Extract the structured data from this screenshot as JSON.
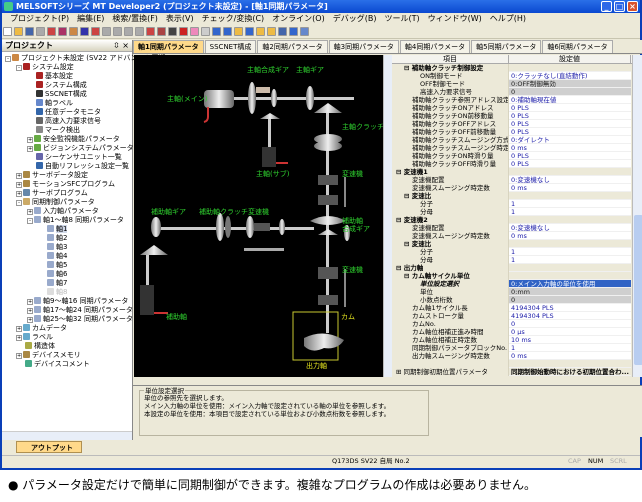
{
  "window": {
    "title": "MELSOFTシリーズ MT Developer2 (プロジェクト未設定) - [軸1同期パラメータ]"
  },
  "menu": [
    "プロジェクト(P)",
    "編集(E)",
    "検索/置換(F)",
    "表示(V)",
    "チェック/変換(C)",
    "オンライン(O)",
    "デバッグ(B)",
    "ツール(T)",
    "ウィンドウ(W)",
    "ヘルプ(H)"
  ],
  "project_panel": {
    "title": "プロジェクト",
    "tree": [
      {
        "label": "プロジェクト未設定 (SV22 アドバンスト同期",
        "level": 0,
        "exp": "-",
        "color": "#c84"
      },
      {
        "label": "システム設定",
        "level": 1,
        "exp": "-",
        "color": "#a22"
      },
      {
        "label": "基本設定",
        "level": 2,
        "color": "#a22"
      },
      {
        "label": "システム構成",
        "level": 2,
        "color": "#a22"
      },
      {
        "label": "SSCNET構成",
        "level": 2,
        "color": "#333"
      },
      {
        "label": "軸ラベル",
        "level": 2,
        "color": "#68c"
      },
      {
        "label": "任意データモニタ",
        "level": 2,
        "color": "#36a"
      },
      {
        "label": "高速入力要求信号",
        "level": 2,
        "color": "#666"
      },
      {
        "label": "マーク検出",
        "level": 2,
        "color": "#888"
      },
      {
        "label": "安全監視機能パラメータ",
        "level": 2,
        "exp": "+",
        "color": "#6a4"
      },
      {
        "label": "ビジョンシステムパラメータ",
        "level": 2,
        "exp": "+",
        "color": "#6a4"
      },
      {
        "label": "シーケンサユニット一覧",
        "level": 2,
        "color": "#66a"
      },
      {
        "label": "自動リフレッシュ設定一覧",
        "level": 2,
        "color": "#36a"
      },
      {
        "label": "サーボデータ設定",
        "level": 1,
        "exp": "+",
        "color": "#a84"
      },
      {
        "label": "モーションSFCプログラム",
        "level": 1,
        "exp": "+",
        "color": "#a84"
      },
      {
        "label": "サーボプログラム",
        "level": 1,
        "exp": "+",
        "color": "#68a"
      },
      {
        "label": "同期制御パラメータ",
        "level": 1,
        "exp": "-",
        "color": "#ca6"
      },
      {
        "label": "入力軸パラメータ",
        "level": 2,
        "exp": "+",
        "color": "#9ac"
      },
      {
        "label": "軸1～軸8 同期パラメータ",
        "level": 2,
        "exp": "-",
        "color": "#9ac"
      },
      {
        "label": "軸1",
        "level": 3,
        "color": "#9ac",
        "sel": true
      },
      {
        "label": "軸2",
        "level": 3,
        "color": "#9ac"
      },
      {
        "label": "軸3",
        "level": 3,
        "color": "#9ac"
      },
      {
        "label": "軸4",
        "level": 3,
        "color": "#9ac"
      },
      {
        "label": "軸5",
        "level": 3,
        "color": "#9ac"
      },
      {
        "label": "軸6",
        "level": 3,
        "color": "#9ac"
      },
      {
        "label": "軸7",
        "level": 3,
        "color": "#9ac"
      },
      {
        "label": "軸8",
        "level": 3,
        "color": "#ddd",
        "dim": true
      },
      {
        "label": "軸9～軸16 同期パラメータ",
        "level": 2,
        "exp": "+",
        "color": "#9ac"
      },
      {
        "label": "軸17～軸24 同期パラメータ",
        "level": 2,
        "exp": "+",
        "color": "#9ac"
      },
      {
        "label": "軸25～軸32 同期パラメータ",
        "level": 2,
        "exp": "+",
        "color": "#9ac"
      },
      {
        "label": "カムデータ",
        "level": 1,
        "exp": "+",
        "color": "#6ac"
      },
      {
        "label": "ラベル",
        "level": 1,
        "exp": "+",
        "color": "#6ac"
      },
      {
        "label": "構造体",
        "level": 1,
        "color": "#aa4"
      },
      {
        "label": "デバイスメモリ",
        "level": 1,
        "exp": "+",
        "color": "#a84"
      },
      {
        "label": "デバイスコメント",
        "level": 1,
        "color": "#4a8"
      }
    ]
  },
  "tabs": [
    {
      "label": "軸1同期パラメータ",
      "active": true
    },
    {
      "label": "SSCNET構成"
    },
    {
      "label": "軸2同期パラメータ"
    },
    {
      "label": "軸3同期パラメータ"
    },
    {
      "label": "軸4同期パラメータ"
    },
    {
      "label": "軸5同期パラメータ"
    },
    {
      "label": "軸6同期パラメータ"
    }
  ],
  "diagram": {
    "labels": {
      "main_comp_gear": "主軸合成ギア",
      "main_gear": "主軸ギア",
      "main_main": "主軸(メイン)",
      "main_clutch": "主軸クラッチ",
      "main_sub": "主軸(サブ)",
      "trans1": "変速機",
      "aux_gear": "補助軸ギア",
      "aux_clutch": "補助軸クラッチ",
      "trans_aux": "変速機",
      "aux_comp_gear_1": "補助軸",
      "aux_comp_gear_2": "合成ギア",
      "trans2": "変速機",
      "aux_axis": "補助軸",
      "cam": "カム",
      "output": "出力軸"
    }
  },
  "properties": {
    "header": {
      "item": "項目",
      "value": "設定値"
    },
    "rows": [
      {
        "name": "補助軸クラッチ制御設定",
        "value": "",
        "indent": 1,
        "type": "sec",
        "exp": "-"
      },
      {
        "name": "ON制御モード",
        "value": "0:クラッチなし(直結動作)",
        "indent": 3
      },
      {
        "name": "OFF制御モード",
        "value": "0:OFF制御無効",
        "indent": 3,
        "type": "gray"
      },
      {
        "name": "高速入力要求信号",
        "value": "0",
        "indent": 3,
        "type": "gray"
      },
      {
        "name": "補助軸クラッチ参照アドレス設定",
        "value": "0:補助軸現在値",
        "indent": 2
      },
      {
        "name": "補助軸クラッチONアドレス",
        "value": "0 PLS",
        "indent": 2
      },
      {
        "name": "補助軸クラッチON前移動量",
        "value": "0 PLS",
        "indent": 2
      },
      {
        "name": "補助軸クラッチOFFアドレス",
        "value": "0 PLS",
        "indent": 2
      },
      {
        "name": "補助軸クラッチOFF前移動量",
        "value": "0 PLS",
        "indent": 2
      },
      {
        "name": "補助軸クラッチスムージング方式",
        "value": "0:ダイレクト",
        "indent": 2
      },
      {
        "name": "補助軸クラッチスムージング時定数",
        "value": "0 ms",
        "indent": 2
      },
      {
        "name": "補助軸クラッチON時滑り量",
        "value": "0 PLS",
        "indent": 2
      },
      {
        "name": "補助軸クラッチOFF時滑り量",
        "value": "0 PLS",
        "indent": 2
      },
      {
        "name": "変速機1",
        "value": "",
        "indent": 0,
        "type": "sec",
        "exp": "-"
      },
      {
        "name": "変速機配置",
        "value": "0:変速機なし",
        "indent": 2
      },
      {
        "name": "変速機スムージング時定数",
        "value": "0 ms",
        "indent": 2
      },
      {
        "name": "変速比",
        "value": "",
        "indent": 1,
        "type": "sec",
        "exp": "-"
      },
      {
        "name": "分子",
        "value": "1",
        "indent": 3
      },
      {
        "name": "分母",
        "value": "1",
        "indent": 3
      },
      {
        "name": "変速機2",
        "value": "",
        "indent": 0,
        "type": "sec",
        "exp": "-"
      },
      {
        "name": "変速機配置",
        "value": "0:変速機なし",
        "indent": 2
      },
      {
        "name": "変速機スムージング時定数",
        "value": "0 ms",
        "indent": 2
      },
      {
        "name": "変速比",
        "value": "",
        "indent": 1,
        "type": "sec",
        "exp": "-"
      },
      {
        "name": "分子",
        "value": "1",
        "indent": 3
      },
      {
        "name": "分母",
        "value": "1",
        "indent": 3
      },
      {
        "name": "出力軸",
        "value": "",
        "indent": 0,
        "type": "sec",
        "exp": "-"
      },
      {
        "name": "カム軸サイクル単位",
        "value": "",
        "indent": 1,
        "type": "sec",
        "exp": "-"
      },
      {
        "name": "単位設定選択",
        "value": "0:メイン入力軸の単位を使用",
        "indent": 3,
        "type": "sel"
      },
      {
        "name": "単位",
        "value": "0:mm",
        "indent": 3,
        "type": "gray"
      },
      {
        "name": "小数点桁数",
        "value": "0",
        "indent": 3,
        "type": "gray"
      },
      {
        "name": "カム軸1サイクル長",
        "value": "4194304 PLS",
        "indent": 2
      },
      {
        "name": "カムストローク量",
        "value": "4194304 PLS",
        "indent": 2
      },
      {
        "name": "カムNo.",
        "value": "0",
        "indent": 2
      },
      {
        "name": "カム軸位相補正進み時間",
        "value": "0 μs",
        "indent": 2
      },
      {
        "name": "カム軸位相補正時定数",
        "value": "10 ms",
        "indent": 2
      },
      {
        "name": "同期制御パラメータブロックNo.",
        "value": "1",
        "indent": 2
      },
      {
        "name": "出力軸スムージング時定数",
        "value": "0 ms",
        "indent": 2
      },
      {
        "name": "",
        "value": "",
        "indent": 0,
        "type": "sec"
      },
      {
        "name": "同期制御初期位置パラメータ",
        "value": "同期制御始動時における初期位置合わ...",
        "indent": 0,
        "type": "bold",
        "exp": "+"
      }
    ]
  },
  "description": {
    "title": "単位設定選択",
    "lines": [
      "単位の参照先を選択します。",
      "メイン入力軸の単位を使用：メイン入力軸で設定されている軸の単位を参照します。",
      "本設定の単位を使用：本項目で設定されている単位および小数点桁数を参照します。"
    ]
  },
  "output_tab": "アウトプット",
  "status": {
    "cpu": "Q173DS  SV22  自局 No.2",
    "cap": "CAP",
    "num": "NUM",
    "scrl": "SCRL"
  },
  "caption": "● パラメータ設定だけで簡単に同期制御ができます。複雑なプログラムの作成は必要ありません。"
}
